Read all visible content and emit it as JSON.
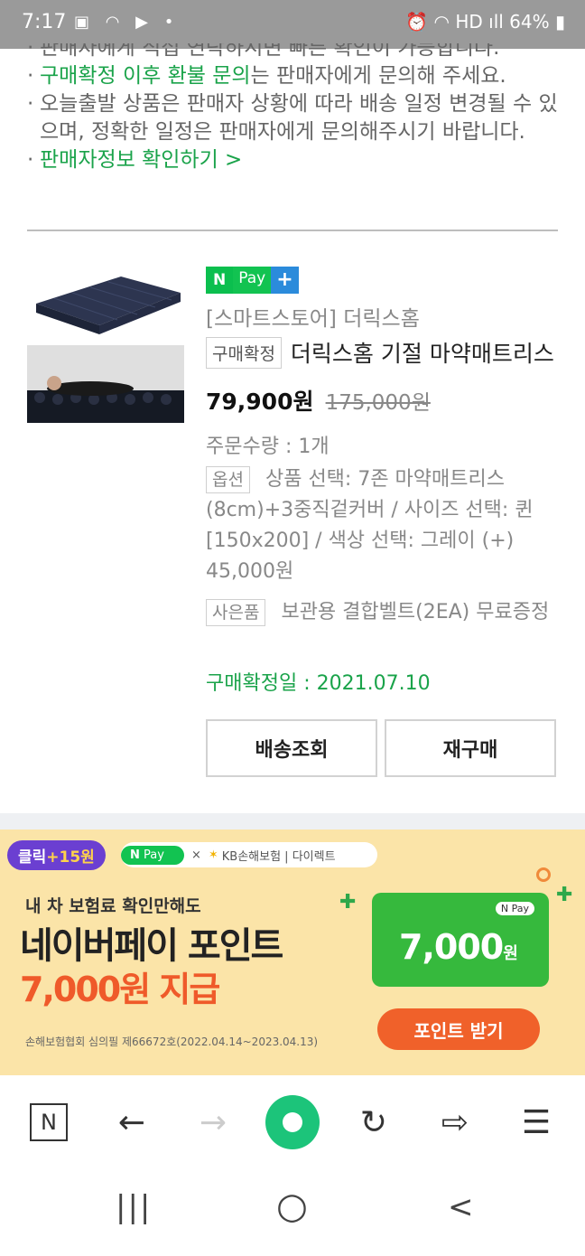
{
  "status_bar": {
    "time": "7:17",
    "left_icons": "▣ ◠ ▶ •",
    "right_icons": "⏰ ◠ HD ıll",
    "battery": "64%"
  },
  "notice": {
    "line0": "판매자에게 직접 연락하시면 빠른 확인이 가능합니다.",
    "line1_green": "구매확정 이후 환불 문의",
    "line1_rest": "는 판매자에게 문의해 주세요.",
    "line2": "오늘출발 상품은 판매자 상황에 따라 배송 일정 변경될 수 있으며, 정확한 일정은 판매자에게 문의해주시기 바랍니다.",
    "seller_link": "판매자정보 확인하기 >"
  },
  "order": {
    "npay_n": "N",
    "npay_label": "Pay",
    "npay_plus": "+",
    "store": "[스마트스토어] 더릭스홈",
    "status_tag": "구매확정",
    "product_title": "더릭스홈 기절 마약매트리스",
    "price": "79,900원",
    "original_price": "175,000원",
    "quantity": "주문수량 : 1개",
    "option_tag": "옵션",
    "option_text": "상품 선택: 7존 마약매트리스(8cm)+3중직겉커버 / 사이즈 선택: 퀸[150x200] / 색상 선택: 그레이 (+) 45,000원",
    "gift_tag": "사은품",
    "gift_text": "보관용 결합벨트(2EA) 무료증정",
    "confirm_date": "구매확정일 : 2021.07.10",
    "btn_tracking": "배송조회",
    "btn_rebuy": "재구매"
  },
  "banner": {
    "click_label": "클릭",
    "click_points": "+15원",
    "partner_npay": "Pay",
    "partner_x": "×",
    "partner_name": "KB손해보험 | 다이렉트",
    "subtitle": "내 차 보험료 확인만해도",
    "headline": "네이버페이 포인트",
    "headline2": "7,000원 지급",
    "card_npay": "N Pay",
    "card_amount": "7,000",
    "card_unit": "원",
    "get_button": "포인트 받기",
    "legal_note": "손해보험협회 심의필 제66672호(2022.04.14~2023.04.13)"
  },
  "browser_bar": {
    "n_logo": "N",
    "back": "←",
    "forward": "→",
    "reload": "↻",
    "share": "⇨",
    "menu": "☰"
  },
  "system_nav": {
    "recents": "|||",
    "home": "○",
    "back": "<"
  }
}
